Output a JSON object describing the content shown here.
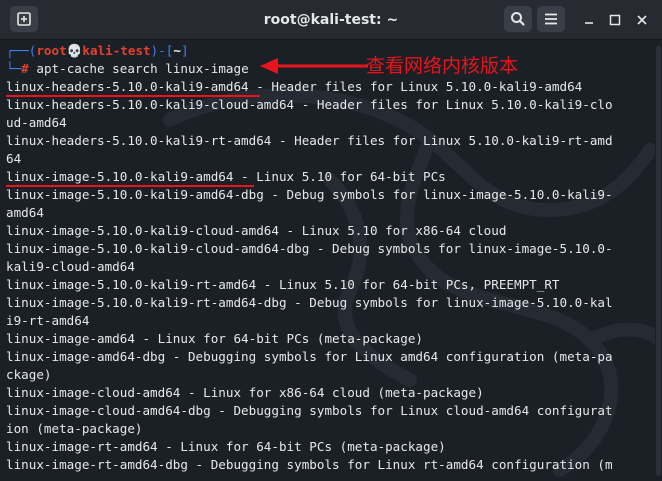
{
  "window": {
    "title": "root@kali-test: ~"
  },
  "prompt": {
    "corner_top": "┌──(",
    "user": "root",
    "skull": "💀",
    "host": "kali-test",
    "sep": ")-[",
    "path": "~",
    "close": "]",
    "corner_bottom": "└─",
    "symbol": "#",
    "command": "apt-cache search linux-image"
  },
  "annotation": {
    "text": "查看网络内核版本"
  },
  "output_lines": [
    "linux-headers-5.10.0-kali9-amd64 - Header files for Linux 5.10.0-kali9-amd64",
    "linux-headers-5.10.0-kali9-cloud-amd64 - Header files for Linux 5.10.0-kali9-clo",
    "ud-amd64",
    "linux-headers-5.10.0-kali9-rt-amd64 - Header files for Linux 5.10.0-kali9-rt-amd",
    "64",
    "linux-image-5.10.0-kali9-amd64 - Linux 5.10 for 64-bit PCs",
    "linux-image-5.10.0-kali9-amd64-dbg - Debug symbols for linux-image-5.10.0-kali9-",
    "amd64",
    "linux-image-5.10.0-kali9-cloud-amd64 - Linux 5.10 for x86-64 cloud",
    "linux-image-5.10.0-kali9-cloud-amd64-dbg - Debug symbols for linux-image-5.10.0-",
    "kali9-cloud-amd64",
    "linux-image-5.10.0-kali9-rt-amd64 - Linux 5.10 for 64-bit PCs, PREEMPT_RT",
    "linux-image-5.10.0-kali9-rt-amd64-dbg - Debug symbols for linux-image-5.10.0-kal",
    "i9-rt-amd64",
    "linux-image-amd64 - Linux for 64-bit PCs (meta-package)",
    "linux-image-amd64-dbg - Debugging symbols for Linux amd64 configuration (meta-pa",
    "ckage)",
    "linux-image-cloud-amd64 - Linux for x86-64 cloud (meta-package)",
    "linux-image-cloud-amd64-dbg - Debugging symbols for Linux cloud-amd64 configurat",
    "ion (meta-package)",
    "linux-image-rt-amd64 - Linux for 64-bit PCs (meta-package)",
    "linux-image-rt-amd64-dbg - Debugging symbols for Linux rt-amd64 configuration (m"
  ],
  "colors": {
    "prompt_frame": "#3b82f6",
    "prompt_user_host": "#e3412f",
    "annotation": "#e8141b",
    "terminal_bg": "#1b1f26",
    "titlebar_bg": "#272a31"
  },
  "icons": {
    "new_tab": "new-tab-icon",
    "search": "search-icon",
    "menu": "hamburger-menu-icon",
    "minimize": "minimize-icon",
    "maximize": "maximize-icon",
    "close": "close-icon"
  }
}
